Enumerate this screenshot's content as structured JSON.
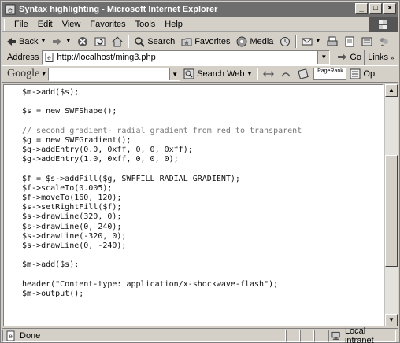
{
  "window": {
    "title": "Syntax highlighting - Microsoft Internet Explorer",
    "controls": {
      "minimize": "_",
      "maximize": "□",
      "close": "×"
    }
  },
  "menu": {
    "items": [
      "File",
      "Edit",
      "View",
      "Favorites",
      "Tools",
      "Help"
    ]
  },
  "toolbar": {
    "back_label": "Back",
    "search_label": "Search",
    "favorites_label": "Favorites",
    "media_label": "Media"
  },
  "address": {
    "label": "Address",
    "url": "http://localhost/ming3.php",
    "go_label": "Go",
    "links_label": "Links"
  },
  "google": {
    "logo": "Google",
    "search_web_label": "Search Web",
    "pagerank_label": "PageRank",
    "options_label": "Op"
  },
  "code": {
    "lines": [
      "$m->add($s);",
      "",
      "$s = new SWFShape();",
      "",
      "// second gradient- radial gradient from red to transparent",
      "$g = new SWFGradient();",
      "$g->addEntry(0.0, 0xff, 0, 0, 0xff);",
      "$g->addEntry(1.0, 0xff, 0, 0, 0);",
      "",
      "$f = $s->addFill($g, SWFFILL_RADIAL_GRADIENT);",
      "$f->scaleTo(0.005);",
      "$f->moveTo(160, 120);",
      "$s->setRightFill($f);",
      "$s->drawLine(320, 0);",
      "$s->drawLine(0, 240);",
      "$s->drawLine(-320, 0);",
      "$s->drawLine(0, -240);",
      "",
      "$m->add($s);",
      "",
      "header(\"Content-type: application/x-shockwave-flash\");",
      "$m->output();"
    ],
    "comment_line_index": 4
  },
  "scrollbar": {
    "position": 0.55
  },
  "status": {
    "text": "Done",
    "zone": "Local intranet"
  }
}
